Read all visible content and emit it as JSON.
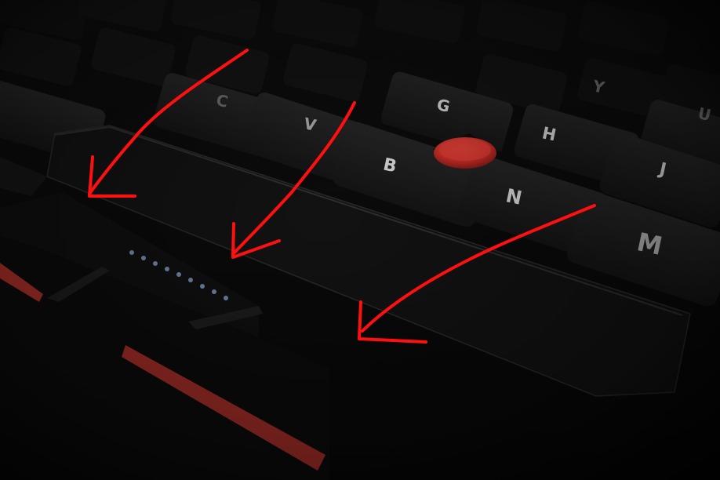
{
  "photo": {
    "subject": "close-up of black laptop keyboard with red pointing stick, hand-drawn red arrows pointing at the space bar area",
    "colors": {
      "background": "#050505",
      "keycap": "#1a1a1a",
      "keycap_top": "#232323",
      "key_letter": "#d8d8d8",
      "trackpoint": "#d8302c",
      "accent_stripe": "#c2352d",
      "annotation_arrow": "#ff1010"
    },
    "keys": {
      "b": "B",
      "n": "N",
      "m": "M",
      "g": "G",
      "h": "H",
      "j": "J",
      "v": "V",
      "c": "C",
      "y": "Y",
      "u": "U"
    },
    "annotations": {
      "arrow_count": 3,
      "arrow_color": "#ff1010"
    }
  }
}
